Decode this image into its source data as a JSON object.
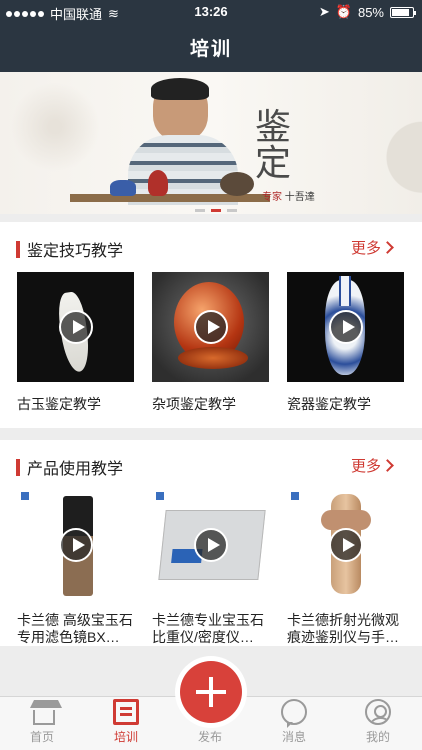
{
  "statusbar": {
    "carrier": "中国联通",
    "time": "13:26",
    "battery": "85%",
    "battery_level": 0.85
  },
  "header": {
    "title": "培训"
  },
  "banner": {
    "mark": "鉴定",
    "sub": "专家",
    "signature": "十吾達"
  },
  "sections": [
    {
      "title": "鉴定技巧教学",
      "more": "更多",
      "items": [
        {
          "label": "古玉鉴定教学"
        },
        {
          "label": "杂项鉴定教学"
        },
        {
          "label": "瓷器鉴定教学"
        }
      ]
    },
    {
      "title": "产品使用教学",
      "more": "更多",
      "items": [
        {
          "label": "卡兰德 高级宝玉石专用滤色镜BX…"
        },
        {
          "label": "卡兰德专业宝玉石比重仪/密度仪…"
        },
        {
          "label": "卡兰德折射光微观痕迹鉴别仪与手…"
        }
      ]
    }
  ],
  "tabbar": {
    "home": "首页",
    "training": "培训",
    "publish": "发布",
    "messages": "消息",
    "me": "我的"
  }
}
